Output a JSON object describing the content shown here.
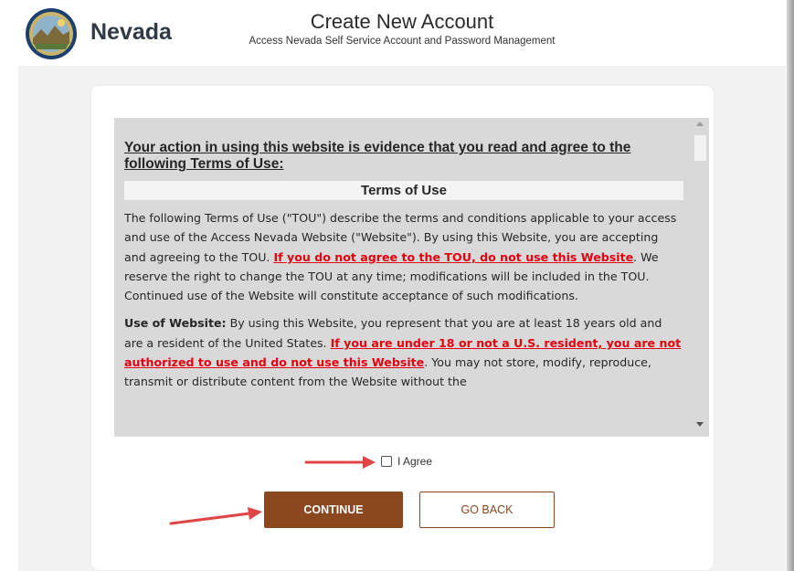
{
  "header": {
    "brand": "Nevada",
    "title": "Create New Account",
    "subtitle": "Access Nevada Self Service Account and Password Management"
  },
  "terms": {
    "lead": "Your action in using this website is evidence that you read and agree to the following Terms of Use:",
    "heading": "Terms of Use",
    "p1_a": "The following Terms of Use (\"TOU\") describe the terms and conditions applicable to your access and use of the Access Nevada Website (\"Website\"). By using this Website, you are accepting and agreeing to the TOU. ",
    "p1_link": "If you do not agree to the TOU, do not use this Website",
    "p1_b": ". We reserve the right to change the TOU at any time; modifications will be included in the TOU. Continued use of the Website will constitute acceptance of such modifications.",
    "p2_label": "Use of Website:",
    "p2_a": " By using this Website, you represent that you are at least 18 years old and are a resident of the United States. ",
    "p2_link": "If you are under 18 or not a U.S. resident, you are not authorized to use and do not use this Website",
    "p2_b": ". You may not store, modify, reproduce, transmit or distribute content from the Website without the"
  },
  "agree": {
    "label": "I Agree",
    "checked": false
  },
  "buttons": {
    "continue": "CONTINUE",
    "back": "GO BACK"
  },
  "colors": {
    "accent": "#8b4720",
    "link_red": "#e3000f",
    "annotation_arrow": "#e04545"
  }
}
